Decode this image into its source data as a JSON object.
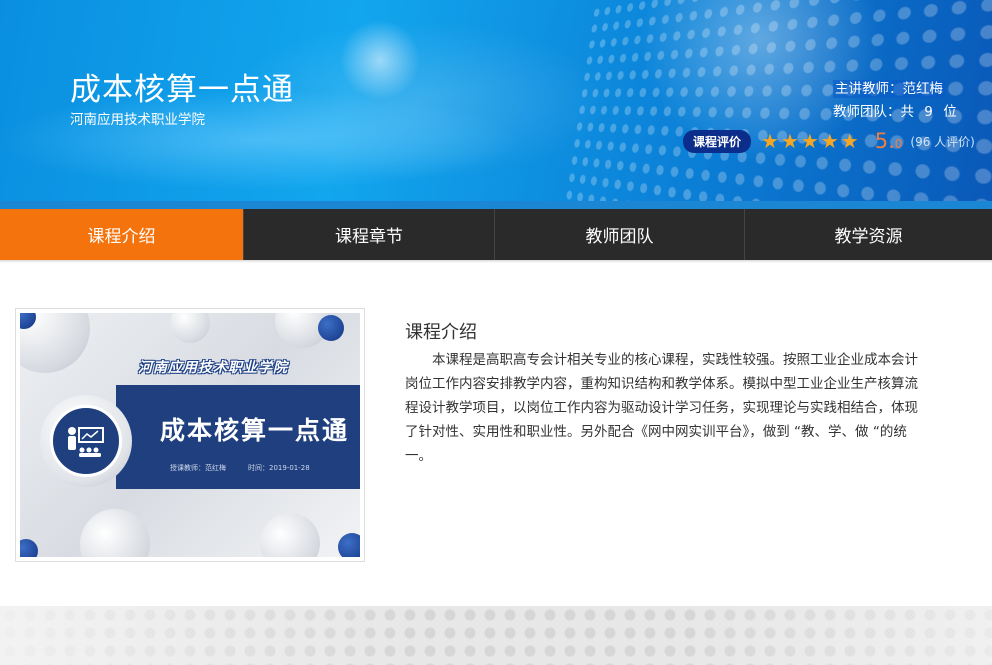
{
  "header": {
    "course_title": "成本核算一点通",
    "school_name": "河南应用技术职业学院",
    "lead_teacher": "主讲教师：范红梅",
    "team_prefix": "教师团队：共",
    "team_count": "9",
    "team_suffix": "位",
    "rating_badge": "课程评价",
    "stars": 5,
    "score_main": "5.",
    "score_decimal": "0",
    "rating_count": "(96 人评价)"
  },
  "nav": {
    "items": [
      {
        "label": "课程介绍",
        "active": true
      },
      {
        "label": "课程章节",
        "active": false
      },
      {
        "label": "教师团队",
        "active": false
      },
      {
        "label": "教学资源",
        "active": false
      }
    ]
  },
  "cover": {
    "school_script": "河南应用技术职业学院",
    "title": "成本核算一点通",
    "meta_teacher": "授课教师：范红梅",
    "meta_time": "时间：2019-01-28"
  },
  "intro": {
    "title": "课程介绍",
    "body": "本课程是高职高专会计相关专业的核心课程，实践性较强。按照工业企业成本会计岗位工作内容安排教学内容，重构知识结构和教学体系。模拟中型工业企业生产核算流程设计教学项目，以岗位工作内容为驱动设计学习任务，实现理论与实践相结合，体现了针对性、实用性和职业性。另外配合《网中网实训平台》，做到 “教、学、做 “的统一。"
  },
  "colors": {
    "nav_active": "#f5730c",
    "nav_bg": "#2a2a2a",
    "star": "#f5a623",
    "score": "#f37d3c",
    "badge": "#0b2e8c"
  }
}
